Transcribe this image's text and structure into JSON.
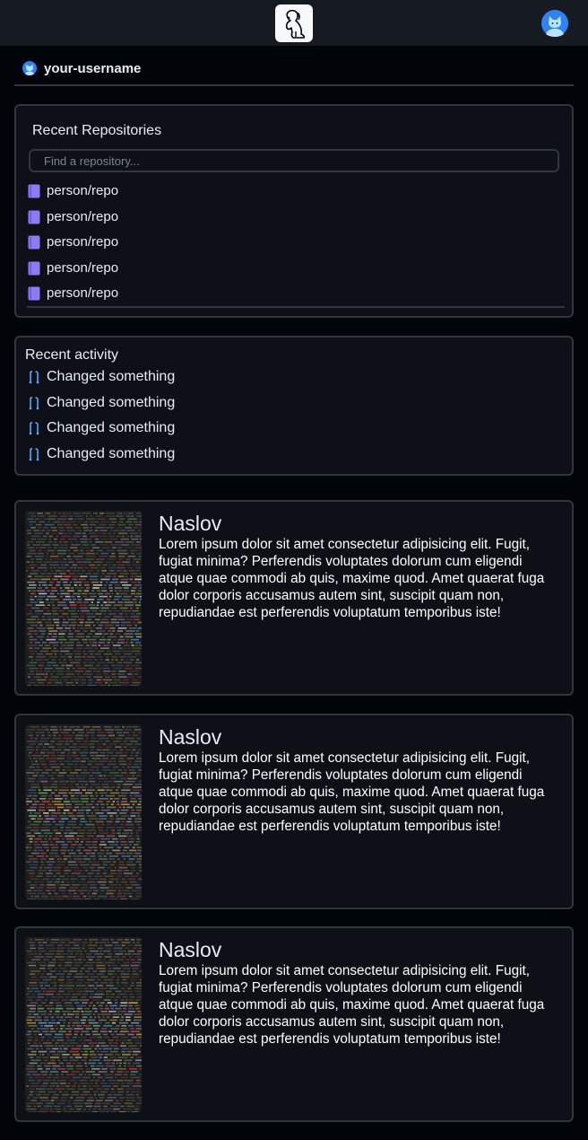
{
  "header": {
    "logo_icon": "puppy-logo-icon",
    "avatar_icon": "cat-avatar-icon"
  },
  "user": {
    "username": "your-username"
  },
  "recent_repositories": {
    "title": "Recent Repositories",
    "search_placeholder": "Find a repository...",
    "items": [
      "person/repo",
      "person/repo",
      "person/repo",
      "person/repo",
      "person/repo"
    ]
  },
  "recent_activity": {
    "title": "Recent activity",
    "items": [
      "Changed something",
      "Changed something",
      "Changed something",
      "Changed something"
    ]
  },
  "cards": [
    {
      "title": "Naslov",
      "body": "Lorem ipsum dolor sit amet consectetur adipisicing elit. Fugit, fugiat minima? Perferendis voluptates dolorum cum eligendi atque quae commodi ab quis, maxime quod. Amet quaerat fuga dolor corporis accusamus autem sint, suscipit quam non, repudiandae est perferendis voluptatum temporibus iste!"
    },
    {
      "title": "Naslov",
      "body": "Lorem ipsum dolor sit amet consectetur adipisicing elit. Fugit, fugiat minima? Perferendis voluptates dolorum cum eligendi atque quae commodi ab quis, maxime quod. Amet quaerat fuga dolor corporis accusamus autem sint, suscipit quam non, repudiandae est perferendis voluptatum temporibus iste!"
    },
    {
      "title": "Naslov",
      "body": "Lorem ipsum dolor sit amet consectetur adipisicing elit. Fugit, fugiat minima? Perferendis voluptates dolorum cum eligendi atque quae commodi ab quis, maxime quod. Amet quaerat fuga dolor corporis accusamus autem sint, suscipit quam non, repudiandae est perferendis voluptatum temporibus iste!"
    }
  ],
  "colors": {
    "page_bg": "#010409",
    "header_bg": "#161b22",
    "panel_bg": "#0d1117",
    "border": "#30363d",
    "text": "#e6edf3",
    "repo_icon": "#8b7cf6",
    "pr_icon": "#58a6ff",
    "avatar": "#2f81f7"
  }
}
